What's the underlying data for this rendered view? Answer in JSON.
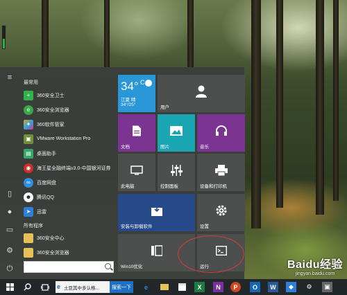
{
  "start_menu": {
    "section_frequent": "最常用",
    "section_all": "所有程序",
    "frequent_apps": [
      {
        "label": "360安全卫士",
        "icon": "360-safe-icon",
        "color": "#2fb34a"
      },
      {
        "label": "360安全浏览器",
        "icon": "360-browser-icon",
        "color": "#3aa845"
      },
      {
        "label": "360软件管家",
        "icon": "360-software-manager-icon",
        "color": "#e8a21c"
      },
      {
        "label": "VMware Workstation Pro",
        "icon": "vmware-icon",
        "color": "#6f8f3a"
      },
      {
        "label": "桌面助手",
        "icon": "desktop-assistant-icon",
        "color": "#35a86a"
      },
      {
        "label": "海王星全融终端v3.0-中国银河证券",
        "icon": "neptune-terminal-icon",
        "color": "#c8302c"
      },
      {
        "label": "百度网盘",
        "icon": "baidu-netdisk-icon",
        "color": "#2d8fe0"
      },
      {
        "label": "腾讯QQ",
        "icon": "qq-icon",
        "color": "#2a84d8"
      },
      {
        "label": "迅雷",
        "icon": "xunlei-icon",
        "color": "#2d7fd8"
      }
    ],
    "all_apps": [
      {
        "label": "360安全中心",
        "icon": "folder-icon",
        "color": "#e6c15a"
      },
      {
        "label": "360安全浏览器",
        "icon": "folder-icon",
        "color": "#e6c15a"
      }
    ]
  },
  "tiles": {
    "weather": {
      "temp": "34°",
      "unit": "C",
      "city": "江夏",
      "condition": "晴",
      "range": "34°/25°"
    },
    "user": "用户",
    "documents": "文档",
    "pictures": "图片",
    "music": "音乐",
    "this_pc": "此电脑",
    "control_panel": "控制面板",
    "devices_printers": "设备和打印机",
    "install_uninstall": "安装与卸载软件",
    "settings": "设置",
    "win10_optimize": "Win10优化",
    "run": "运行"
  },
  "taskbar": {
    "search_text": "土豆其中多认格...",
    "search_button": "搜索一下"
  },
  "watermark": {
    "logo": "Baidu经验",
    "url": "jingyan.baidu.com"
  },
  "colors": {
    "tile_blue": "#2a97d9",
    "tile_purple": "#7c3493",
    "tile_teal": "#1aa5b3",
    "tile_navy": "#274a8a",
    "tile_gray": "#4c4f4e",
    "circle_red": "#d83a3a"
  }
}
